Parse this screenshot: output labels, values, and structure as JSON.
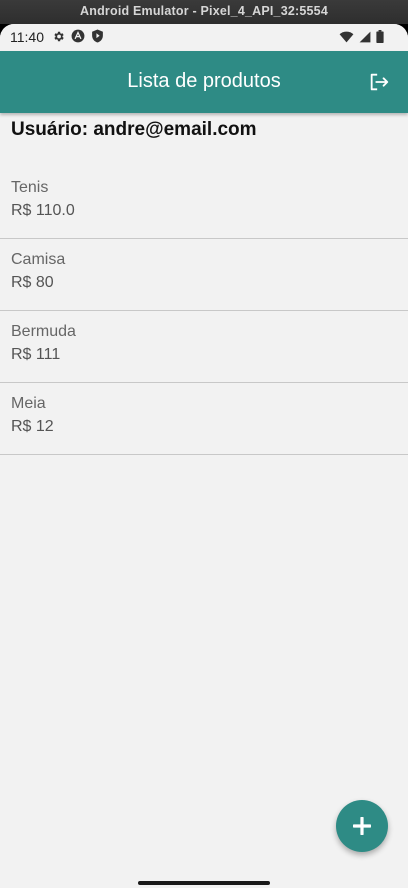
{
  "window": {
    "title": "Android Emulator - Pixel_4_API_32:5554"
  },
  "status_bar": {
    "time": "11:40",
    "left_icons": [
      "gear-icon",
      "a-circle-icon",
      "shield-play-icon"
    ],
    "right_icons": [
      "wifi-icon",
      "signal-icon",
      "battery-icon"
    ]
  },
  "app_bar": {
    "title": "Lista de produtos",
    "action_icon": "logout-icon",
    "color": "#2e8b85"
  },
  "user": {
    "label": "Usuário: andre@email.com"
  },
  "products": [
    {
      "name": "Tenis",
      "price": "R$ 110.0"
    },
    {
      "name": "Camisa",
      "price": "R$ 80"
    },
    {
      "name": "Bermuda",
      "price": "R$ 111"
    },
    {
      "name": "Meia",
      "price": "R$ 12"
    }
  ],
  "fab": {
    "icon": "plus-icon",
    "color": "#2e8b85"
  }
}
